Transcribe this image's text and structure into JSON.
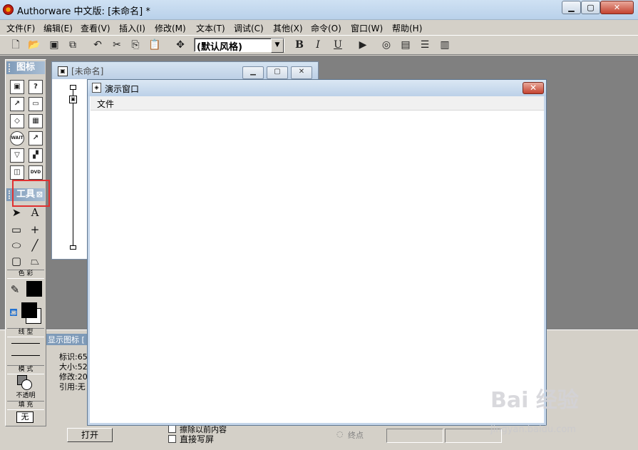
{
  "window": {
    "title": "Authorware 中文版: [未命名] *",
    "min_label": "▁",
    "max_label": "▢",
    "close_label": "✕"
  },
  "menu": [
    "文件(F)",
    "编辑(E)",
    "查看(V)",
    "插入(I)",
    "修改(M)",
    "文本(T)",
    "调试(C)",
    "其他(X)",
    "命令(O)",
    "窗口(W)",
    "帮助(H)"
  ],
  "toolbar": {
    "style_value": "(默认风格)",
    "bold": "B",
    "italic": "I",
    "underline": "U"
  },
  "palette": {
    "icons_title": "图标",
    "tools_title": "工具",
    "color_label": "色 彩",
    "line_label": "线 型",
    "mode_label": "模 式",
    "mode_value": "不透明",
    "fill_label": "填 充",
    "fill_value": "无"
  },
  "flow_window": {
    "title": "[未命名]"
  },
  "presentation": {
    "title": "演示窗口",
    "menu_file": "文件"
  },
  "properties": {
    "panel_title": "显示图标 [",
    "id_label": "标识:65",
    "size_label": "大小:52",
    "modified_label": "修改:20",
    "ref_label": "引用:无",
    "open_button": "打开",
    "erase_label": "擦除以前内容",
    "direct_label": "直接写屏",
    "endpoint_label": "终点"
  },
  "watermark": {
    "text": "Bai 经验",
    "url": "jingyan.baidu.com"
  }
}
